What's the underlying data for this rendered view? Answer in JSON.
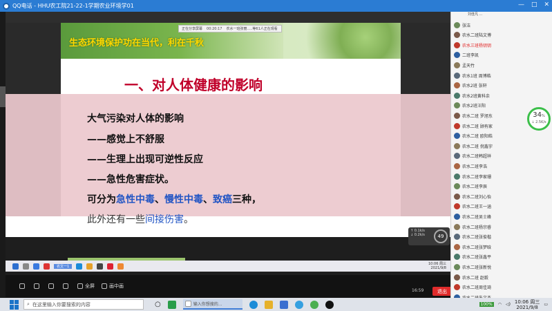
{
  "window": {
    "title": "QQ电话 - HHU农工院21-22-1学期农业环境学01",
    "controls": [
      "—",
      "□",
      "✕"
    ]
  },
  "share_tag": {
    "status": "正在分享屏幕",
    "time": "00:20:17",
    "note": "农水一班张丽.....等61人正在观看"
  },
  "slide": {
    "motto": "生态环境保护功在当代，利在千秋",
    "heading": "一、对人体健康的影响",
    "lines": [
      "大气污染对人体的影响",
      "——感觉上不舒服",
      "——生理上出现可逆性反应",
      "——急性危害症状。"
    ],
    "line5": {
      "prefix": "可分为",
      "h1": "急性中毒",
      "sep1": "、",
      "h2": "慢性中毒",
      "sep2": "、",
      "h3": "致癌",
      "suffix": "三种，"
    },
    "line6": {
      "prefix": "此外还有一些",
      "highlight": "间接伤害",
      "suffix": "。"
    }
  },
  "net_widget": {
    "up": "↑ 0.1k/s",
    "down": "↓ 0.2k/s",
    "percent": "49"
  },
  "inner_taskbar": {
    "active_label": "农文一1",
    "time": "10:06 周三",
    "date": "2021/9/8"
  },
  "toolbar": {
    "items": [
      "",
      "",
      "",
      "",
      "全屏",
      "画中画"
    ],
    "signal": "16:59",
    "quit_label": "退出"
  },
  "sidebar": {
    "header": "刘佳凡 ...",
    "members": [
      "张洁",
      "农水二班陆文博",
      "农水三班杨钥钥",
      "二班李凯",
      "孟天竹",
      "农水1班 周博皓",
      "农水2班 张轩",
      "农水2班黄科余",
      "农水2班汪阳",
      "农水二班 罗旭东",
      "农水二班 顾有家",
      "农水二班 欧阳皓",
      "农水二班 倪鑫宇",
      "农水二班韩超祥",
      "农水二班李浩",
      "农水二班李家珊",
      "农水二班李辰",
      "农水二班刘心怡",
      "农水二班王一涵",
      "农水二班吴士峰",
      "农水二班杨宗睿",
      "农水二班张俊楷",
      "农水二班张梦晗",
      "农水二班张鑫平",
      "农水二班张新悦",
      "农水二班 赵毅",
      "农水二班周佳琦",
      "农水二班朱文杰"
    ],
    "highlight_index": 2
  },
  "speed_ring": {
    "value": "34",
    "unit": "%",
    "rate": "↓ 2.5K/s"
  },
  "taskbar": {
    "search_placeholder": "在这里输入你要搜索的内容",
    "active_app": "输入你想搜的...",
    "tray_percent": "100%",
    "time": "10:06 周三",
    "date": "2021/9/8"
  },
  "colors": {
    "titlebar": "#2b7cd3",
    "motto": "#ffd800",
    "heading": "#c0002a",
    "highlight": "#2255c4",
    "quit": "#e02b2b",
    "ring": "#3cbf4a"
  }
}
